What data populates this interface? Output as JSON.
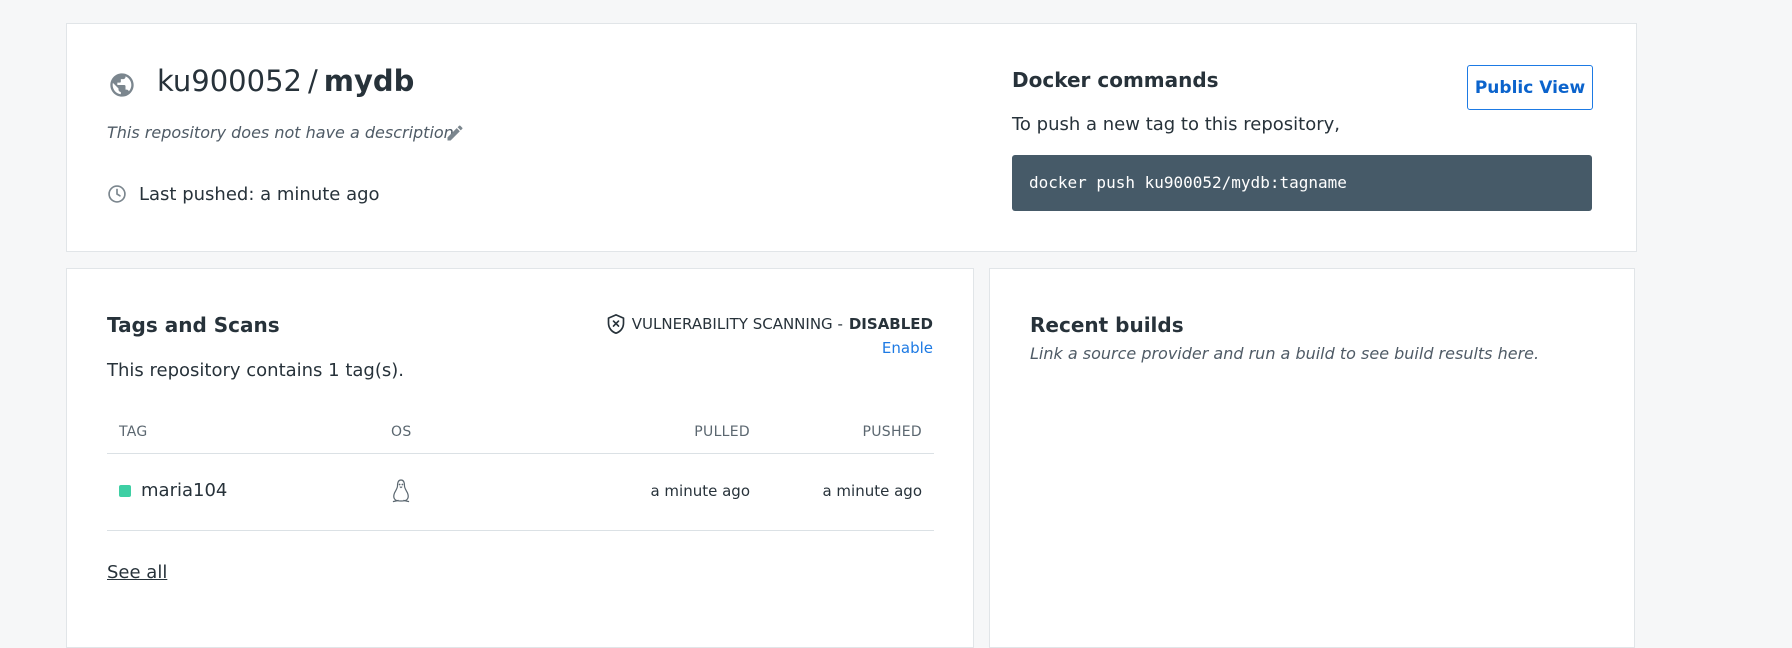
{
  "repo": {
    "namespace": "ku900052",
    "separator": "/",
    "name": "mydb",
    "description": "This repository does not have a description",
    "last_pushed": "Last pushed: a minute ago"
  },
  "docker_commands": {
    "title": "Docker commands",
    "subtitle": "To push a new tag to this repository,",
    "command": "docker push ku900052/mydb:tagname",
    "public_view_label": "Public View"
  },
  "tags": {
    "title": "Tags and Scans",
    "count_text": "This repository contains 1 tag(s).",
    "vulnerability_label": "VULNERABILITY SCANNING - ",
    "vulnerability_status": "DISABLED",
    "enable_label": "Enable",
    "columns": [
      "TAG",
      "OS",
      "PULLED",
      "PUSHED"
    ],
    "rows": [
      {
        "tag": "maria104",
        "os_icon": "linux-icon",
        "pulled": "a minute ago",
        "pushed": "a minute ago"
      }
    ],
    "see_all_label": "See all"
  },
  "builds": {
    "title": "Recent builds",
    "subtitle": "Link a source provider and run a build to see build results here."
  },
  "colors": {
    "accent": "#1d7ae4",
    "command_bg": "#465a68",
    "tag_status": "#3ecfa4",
    "page_bg": "#f6f7f8"
  }
}
